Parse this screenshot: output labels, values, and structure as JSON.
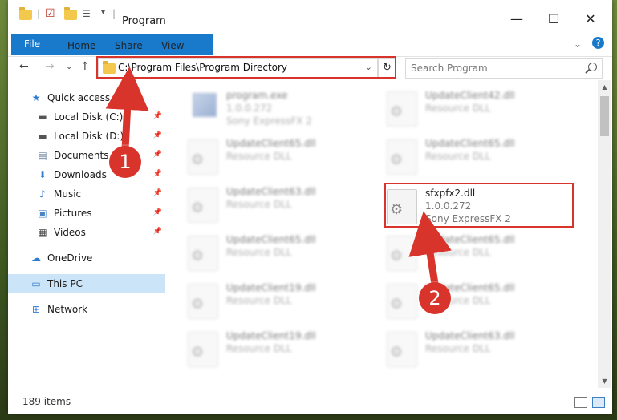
{
  "window": {
    "title": "Program",
    "controls": [
      "—",
      "☐",
      "✕"
    ]
  },
  "ribbon": {
    "tabs": [
      "File",
      "Home",
      "Share",
      "View"
    ],
    "help": "?"
  },
  "nav": {
    "path": "C:\\Program Files\\Program Directory",
    "search_placeholder": "Search Program"
  },
  "sidebar": {
    "items": [
      {
        "label": "Quick access",
        "icon": "star-icon"
      },
      {
        "label": "Local Disk (C:)",
        "icon": "drive-icon",
        "pinned": true
      },
      {
        "label": "Local Disk (D:)",
        "icon": "drive-icon",
        "pinned": true
      },
      {
        "label": "Documents",
        "icon": "documents-icon",
        "pinned": true
      },
      {
        "label": "Downloads",
        "icon": "download-icon",
        "pinned": true
      },
      {
        "label": "Music",
        "icon": "music-icon",
        "pinned": true
      },
      {
        "label": "Pictures",
        "icon": "pictures-icon",
        "pinned": true
      },
      {
        "label": "Videos",
        "icon": "videos-icon",
        "pinned": true
      },
      {
        "label": "OneDrive",
        "icon": "cloud-icon"
      },
      {
        "label": "This PC",
        "icon": "computer-icon",
        "selected": true
      },
      {
        "label": "Network",
        "icon": "network-icon"
      }
    ]
  },
  "files": {
    "left": [
      {
        "name": "program.exe",
        "line2": "1.0.0.272",
        "line3": "Sony ExpressFX 2"
      },
      {
        "name": "UpdateClient65.dll",
        "line2": "Resource DLL"
      },
      {
        "name": "UpdateClient63.dll",
        "line2": "Resource DLL"
      },
      {
        "name": "UpdateClient65.dll",
        "line2": "Resource DLL"
      },
      {
        "name": "UpdateClient19.dll",
        "line2": "Resource DLL"
      },
      {
        "name": "UpdateClient19.dll",
        "line2": "Resource DLL"
      }
    ],
    "right": [
      {
        "name": "UpdateClient42.dll",
        "line2": "Resource DLL"
      },
      {
        "name": "UpdateClient65.dll",
        "line2": "Resource DLL"
      },
      {
        "name": "sfxpfx2.dll",
        "line2": "1.0.0.272",
        "line3": "Sony ExpressFX 2",
        "highlighted": true
      },
      {
        "name": "UpdateClient65.dll",
        "line2": "Resource DLL"
      },
      {
        "name": "UpdateClient65.dll",
        "line2": "Resource DLL"
      },
      {
        "name": "UpdateClient63.dll",
        "line2": "Resource DLL"
      }
    ]
  },
  "status": {
    "item_count": "189 items"
  },
  "annotations": {
    "marker1": "1",
    "marker2": "2",
    "color": "#d9342b"
  }
}
